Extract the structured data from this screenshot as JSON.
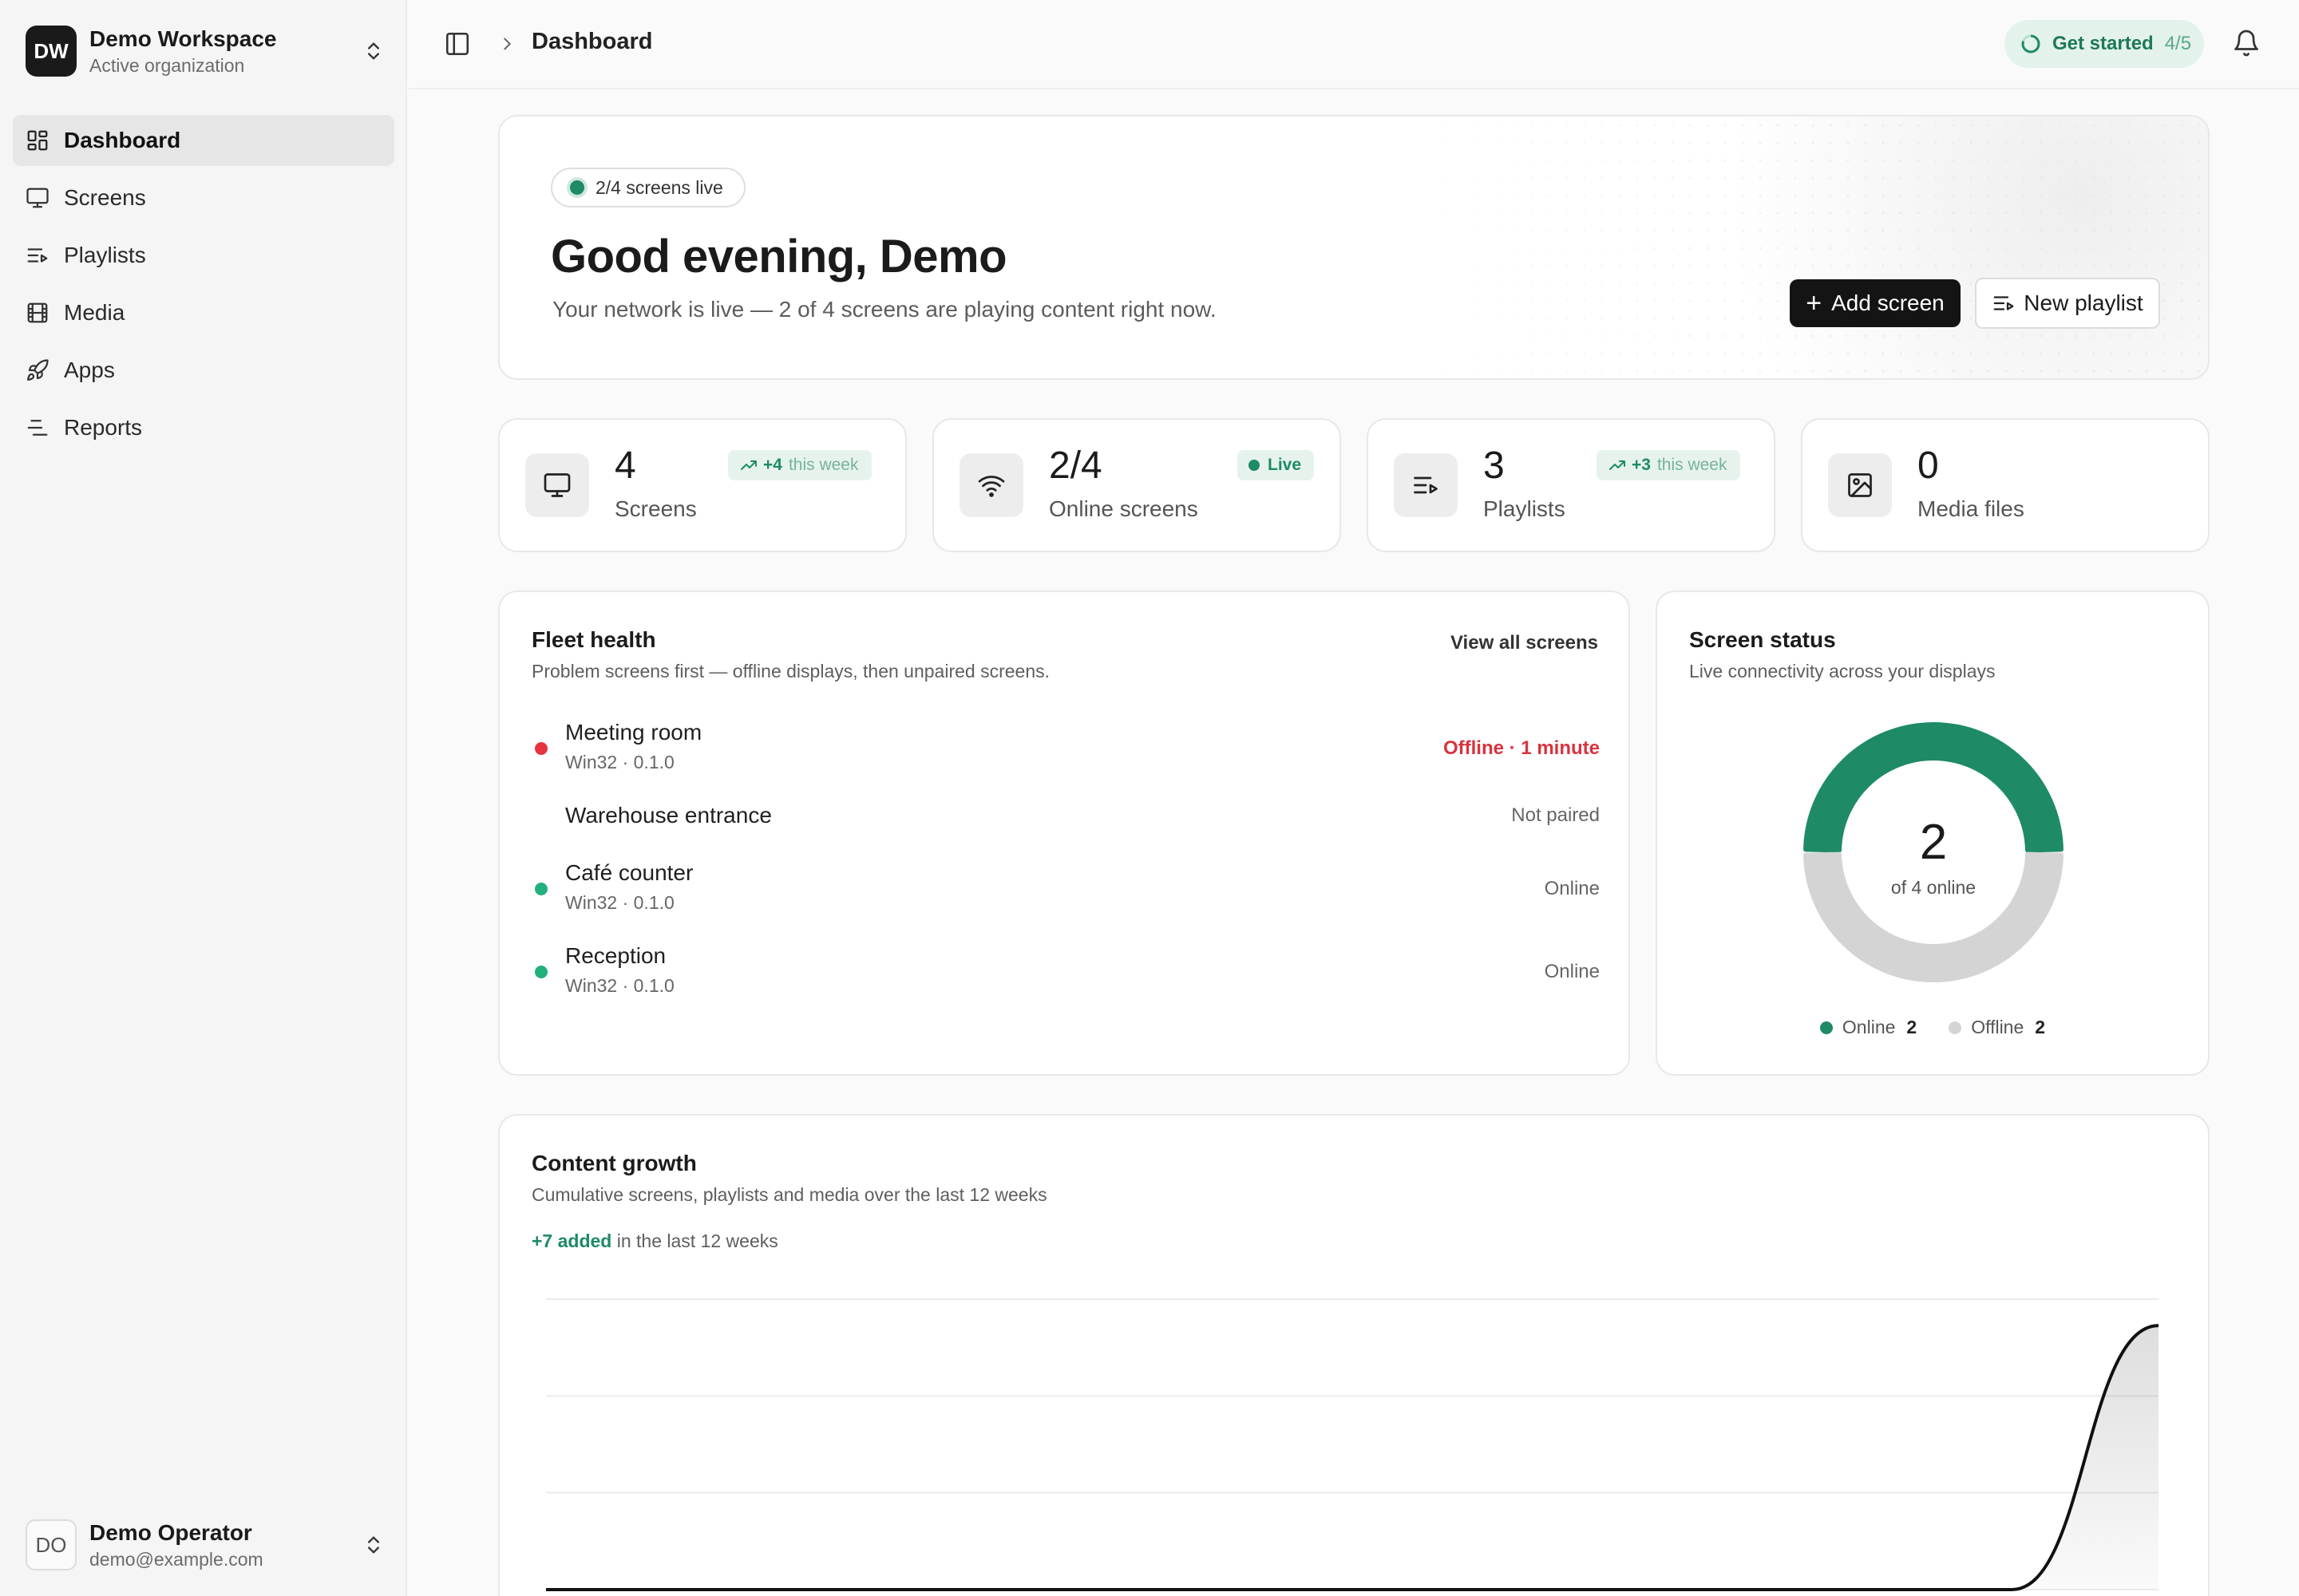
{
  "workspace": {
    "initials": "DW",
    "name": "Demo Workspace",
    "subtitle": "Active organization"
  },
  "nav": [
    {
      "label": "Dashboard",
      "icon": "grid-icon",
      "active": true
    },
    {
      "label": "Screens",
      "icon": "monitor-icon"
    },
    {
      "label": "Playlists",
      "icon": "list-play-icon"
    },
    {
      "label": "Media",
      "icon": "film-icon"
    },
    {
      "label": "Apps",
      "icon": "rocket-icon"
    },
    {
      "label": "Reports",
      "icon": "reports-icon"
    }
  ],
  "user": {
    "initials": "DO",
    "name": "Demo Operator",
    "email": "demo@example.com"
  },
  "topbar": {
    "breadcrumb": "Dashboard",
    "get_started_label": "Get started",
    "get_started_progress": "4/5"
  },
  "hero": {
    "pill": "2/4 screens live",
    "greeting": "Good evening, Demo",
    "subtitle": "Your network is live — 2 of 4 screens are playing content right now.",
    "add_screen_label": "Add screen",
    "new_playlist_label": "New playlist"
  },
  "stats": [
    {
      "value": "4",
      "label": "Screens",
      "badge_value": "+4",
      "badge_suffix": "this week",
      "icon": "monitor-icon"
    },
    {
      "value": "2/4",
      "label": "Online screens",
      "badge_value": "Live",
      "icon": "wifi-icon"
    },
    {
      "value": "3",
      "label": "Playlists",
      "badge_value": "+3",
      "badge_suffix": "this week",
      "icon": "list-play-icon"
    },
    {
      "value": "0",
      "label": "Media files",
      "icon": "image-icon"
    }
  ],
  "fleet": {
    "title": "Fleet health",
    "subtitle": "Problem screens first — offline displays, then unpaired screens.",
    "view_all": "View all screens",
    "rows": [
      {
        "name": "Meeting room",
        "meta": "Win32 · 0.1.0",
        "status": "Offline · 1 minute",
        "state": "offline"
      },
      {
        "name": "Warehouse entrance",
        "meta": "",
        "status": "Not paired",
        "state": "unpaired"
      },
      {
        "name": "Café counter",
        "meta": "Win32 · 0.1.0",
        "status": "Online",
        "state": "online"
      },
      {
        "name": "Reception",
        "meta": "Win32 · 0.1.0",
        "status": "Online",
        "state": "online"
      }
    ]
  },
  "screen_status": {
    "title": "Screen status",
    "subtitle": "Live connectivity across your displays",
    "center_value": "2",
    "center_label": "of 4 online",
    "legend": [
      {
        "label": "Online",
        "value": "2",
        "color": "#1e8a66"
      },
      {
        "label": "Offline",
        "value": "2",
        "color": "#d4d4d4"
      }
    ]
  },
  "growth": {
    "title": "Content growth",
    "subtitle": "Cumulative screens, playlists and media over the last 12 weeks",
    "added_value": "+7 added",
    "added_suffix": "in the last 12 weeks"
  },
  "chart_data": [
    {
      "type": "pie",
      "title": "Screen status",
      "categories": [
        "Online",
        "Offline"
      ],
      "values": [
        2,
        2
      ],
      "colors": [
        "#1e8a66",
        "#d4d4d4"
      ],
      "legend": "bottom"
    },
    {
      "type": "area",
      "title": "Content growth",
      "x": [
        1,
        2,
        3,
        4,
        5,
        6,
        7,
        8,
        9,
        10,
        11,
        12
      ],
      "values": [
        0,
        0,
        0,
        0,
        0,
        0,
        0,
        0,
        0,
        0,
        0,
        7
      ],
      "grid": true,
      "ylim": [
        0,
        7.7
      ]
    }
  ],
  "colors": {
    "accent": "#1e8a66",
    "offline": "#d9333f",
    "online_dot": "#22b07d"
  }
}
